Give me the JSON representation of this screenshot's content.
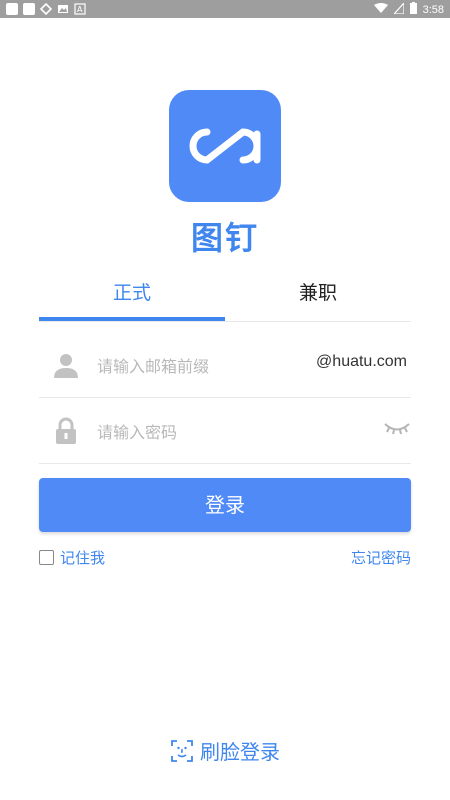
{
  "status_bar": {
    "time": "3:58"
  },
  "app": {
    "name": "图钉",
    "brand_color": "#4f8af6"
  },
  "tabs": [
    {
      "label": "正式",
      "active": true
    },
    {
      "label": "兼职",
      "active": false
    }
  ],
  "email_field": {
    "placeholder": "请输入邮箱前缀",
    "suffix": "@huatu.com",
    "icon": "user-icon"
  },
  "password_field": {
    "placeholder": "请输入密码",
    "icon": "lock-icon",
    "toggle_icon": "eye-closed-icon"
  },
  "login_button": {
    "label": "登录"
  },
  "remember_me": {
    "label": "记住我",
    "checked": false
  },
  "forgot_password": {
    "label": "忘记密码"
  },
  "face_login": {
    "label": "刷脸登录",
    "icon": "face-scan-icon"
  }
}
